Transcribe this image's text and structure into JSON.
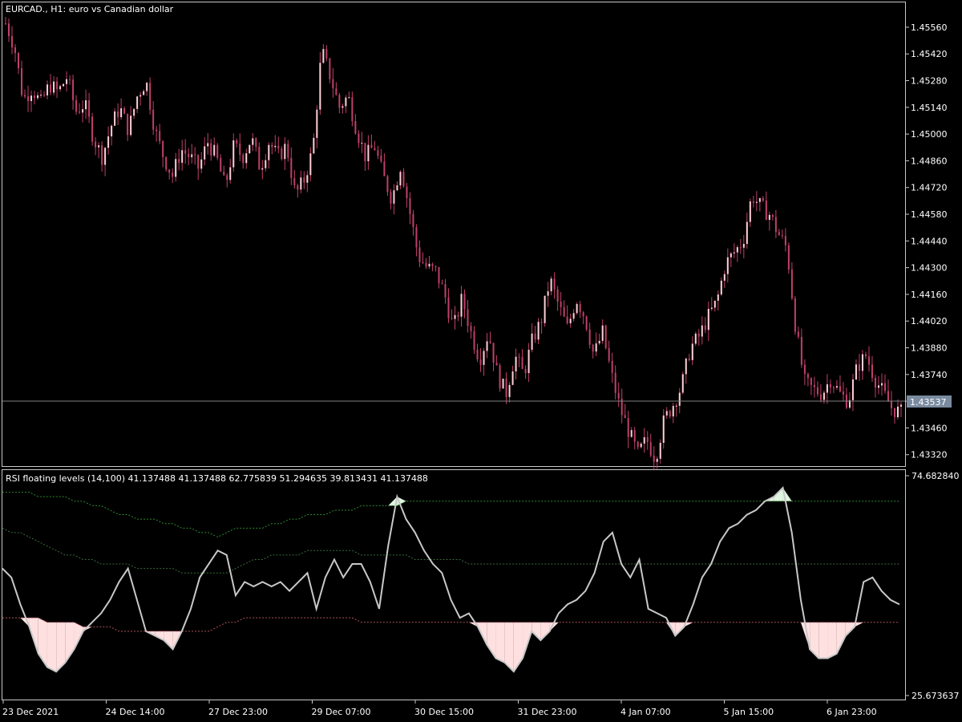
{
  "main": {
    "title": "EURCAD., H1:  euro vs Canadian dollar",
    "price_levels": [
      "1.45560",
      "1.45420",
      "1.45280",
      "1.45140",
      "1.45000",
      "1.44860",
      "1.44720",
      "1.44580",
      "1.44440",
      "1.44300",
      "1.44160",
      "1.44020",
      "1.43880",
      "1.43740",
      "1.43600",
      "1.43460",
      "1.43320"
    ],
    "current_price": "1.43537",
    "colors": {
      "candle": "#c0406a",
      "candle_up": "#ffd0d8",
      "current_line": "#808080",
      "price_tag_bg": "#7a8ba0"
    }
  },
  "indicator": {
    "title": "RSI floating levels (14,100) 41.137488 41.137488 62.775839 51.294635 39.813431 41.137488",
    "max_label": "74.682840",
    "min_label": "25.673637",
    "colors": {
      "rsi": "#c8c8c8",
      "upper": "#2e8b2e",
      "mid": "#3a6e3a",
      "lower": "#b05060",
      "fill_high": "#dff5df",
      "fill_low": "#ffe0e0"
    }
  },
  "time_axis": [
    "23 Dec 2021",
    "24 Dec 14:00",
    "27 Dec 23:00",
    "29 Dec 07:00",
    "30 Dec 15:00",
    "31 Dec 23:00",
    "4 Jan 07:00",
    "5 Jan 15:00",
    "6 Jan 23:00"
  ],
  "chart_data": [
    {
      "type": "candlestick",
      "title": "EURCAD., H1:  euro vs Canadian dollar",
      "y_ticks": [
        1.4556,
        1.4542,
        1.4528,
        1.4514,
        1.45,
        1.4486,
        1.4472,
        1.4458,
        1.4444,
        1.443,
        1.4416,
        1.4402,
        1.4388,
        1.4374,
        1.436,
        1.4346,
        1.4332
      ],
      "ylim": [
        1.4326,
        1.4569
      ],
      "current_price": 1.43537,
      "x_labels": [
        "23 Dec 2021",
        "24 Dec 14:00",
        "27 Dec 23:00",
        "29 Dec 07:00",
        "30 Dec 15:00",
        "31 Dec 23:00",
        "4 Jan 07:00",
        "5 Jan 15:00",
        "6 Jan 23:00"
      ],
      "close_path": [
        1.4558,
        1.4546,
        1.4518,
        1.4524,
        1.4516,
        1.4526,
        1.4522,
        1.453,
        1.4512,
        1.4516,
        1.4498,
        1.4488,
        1.4504,
        1.4514,
        1.4502,
        1.452,
        1.4528,
        1.4502,
        1.4488,
        1.4478,
        1.4492,
        1.4488,
        1.4482,
        1.4496,
        1.4488,
        1.4472,
        1.4494,
        1.4488,
        1.4498,
        1.4482,
        1.4496,
        1.4488,
        1.4494,
        1.4468,
        1.4476,
        1.4492,
        1.4544,
        1.453,
        1.4514,
        1.452,
        1.4502,
        1.4488,
        1.4494,
        1.4478,
        1.4466,
        1.4484,
        1.446,
        1.4436,
        1.443,
        1.4428,
        1.4416,
        1.4398,
        1.4414,
        1.4396,
        1.4382,
        1.4396,
        1.4374,
        1.4364,
        1.4384,
        1.4374,
        1.4392,
        1.4402,
        1.4424,
        1.441,
        1.4398,
        1.4414,
        1.4404,
        1.4384,
        1.4396,
        1.4374,
        1.4356,
        1.4344,
        1.4332,
        1.434,
        1.433,
        1.435,
        1.4358,
        1.4368,
        1.4388,
        1.4394,
        1.4404,
        1.4412,
        1.4432,
        1.4438,
        1.4444,
        1.4468,
        1.4462,
        1.4458,
        1.4448,
        1.444,
        1.4398,
        1.437,
        1.4366,
        1.4364,
        1.4372,
        1.4364,
        1.436,
        1.4378,
        1.4384,
        1.4372,
        1.4364,
        1.4356,
        1.4354
      ]
    },
    {
      "type": "line",
      "title": "RSI floating levels (14,100) 41.137488 41.137488 62.775839 51.294635 39.813431 41.137488",
      "ylim": [
        25.673637,
        74.68284
      ],
      "series": [
        {
          "values": [
            54,
            52,
            46,
            41,
            35,
            32,
            31,
            33,
            36,
            40,
            42,
            44,
            47,
            51,
            54,
            47,
            40,
            39,
            38,
            36,
            40,
            45,
            52,
            55,
            58,
            57,
            48,
            51,
            50,
            51,
            50,
            51,
            49,
            51,
            53,
            45,
            52,
            56,
            52,
            55,
            55,
            51,
            45,
            59,
            70,
            65,
            62,
            58,
            55,
            53,
            47,
            43,
            44,
            41,
            37,
            34,
            33,
            31,
            34,
            40,
            38,
            40,
            44,
            46,
            47,
            49,
            53,
            60,
            62,
            55,
            52,
            56,
            45,
            44,
            43,
            39,
            41,
            46,
            52,
            55,
            60,
            63,
            64,
            66,
            67,
            69,
            70,
            72,
            62,
            47,
            36,
            34,
            34,
            35,
            39,
            41,
            51,
            52,
            49,
            47,
            46
          ]
        },
        {
          "values": [
            71,
            71,
            71,
            71,
            70,
            70,
            70,
            70,
            69,
            69,
            68,
            68,
            67,
            66,
            66,
            65,
            65,
            65,
            64,
            64,
            63,
            63,
            62,
            62,
            61,
            62,
            63,
            63,
            63,
            63,
            64,
            64,
            65,
            65,
            66,
            66,
            66,
            67,
            67,
            67,
            68,
            68,
            68,
            68,
            68,
            69,
            69,
            69,
            69,
            69,
            69,
            69,
            69,
            69,
            69,
            69,
            69,
            69,
            69,
            69,
            69,
            69,
            69,
            69,
            69,
            69,
            69,
            69,
            69,
            69,
            69,
            69,
            69,
            69,
            69,
            69,
            69,
            69,
            69,
            69,
            69,
            69,
            69,
            69,
            69,
            69,
            69,
            69,
            69,
            69,
            69,
            69,
            69,
            69,
            69,
            69,
            69,
            69,
            69,
            69,
            69
          ]
        },
        {
          "values": [
            63,
            62,
            62,
            61,
            60,
            59,
            58,
            57,
            57,
            56,
            56,
            55,
            55,
            55,
            55,
            54,
            54,
            54,
            54,
            54,
            53,
            53,
            53,
            53,
            53,
            53,
            54,
            55,
            56,
            56,
            57,
            57,
            57,
            57,
            58,
            58,
            58,
            58,
            58,
            58,
            57,
            57,
            57,
            57,
            57,
            57,
            56,
            56,
            56,
            56,
            56,
            56,
            55,
            55,
            55,
            55,
            55,
            55,
            55,
            55,
            55,
            55,
            55,
            55,
            55,
            55,
            55,
            55,
            55,
            55,
            55,
            55,
            55,
            55,
            55,
            55,
            55,
            55,
            55,
            55,
            55,
            55,
            55,
            55,
            55,
            55,
            55,
            55,
            55,
            55,
            55,
            55,
            55,
            55,
            55,
            55,
            55,
            55,
            55,
            55,
            55
          ]
        },
        {
          "values": [
            43,
            43,
            43,
            43,
            43,
            42,
            42,
            42,
            42,
            41,
            41,
            41,
            41,
            40,
            40,
            40,
            40,
            40,
            40,
            40,
            40,
            40,
            40,
            40,
            41,
            42,
            42,
            43,
            43,
            43,
            43,
            43,
            43,
            43,
            43,
            43,
            43,
            43,
            43,
            43,
            42,
            42,
            42,
            42,
            42,
            42,
            42,
            42,
            42,
            42,
            42,
            42,
            42,
            42,
            42,
            42,
            42,
            42,
            42,
            42,
            42,
            42,
            42,
            42,
            42,
            42,
            42,
            42,
            42,
            42,
            42,
            42,
            42,
            42,
            42,
            42,
            42,
            42,
            42,
            42,
            42,
            42,
            42,
            42,
            42,
            42,
            42,
            42,
            42,
            42,
            42,
            42,
            42,
            42,
            42,
            42,
            42,
            42,
            42,
            42,
            42
          ]
        }
      ]
    }
  ]
}
